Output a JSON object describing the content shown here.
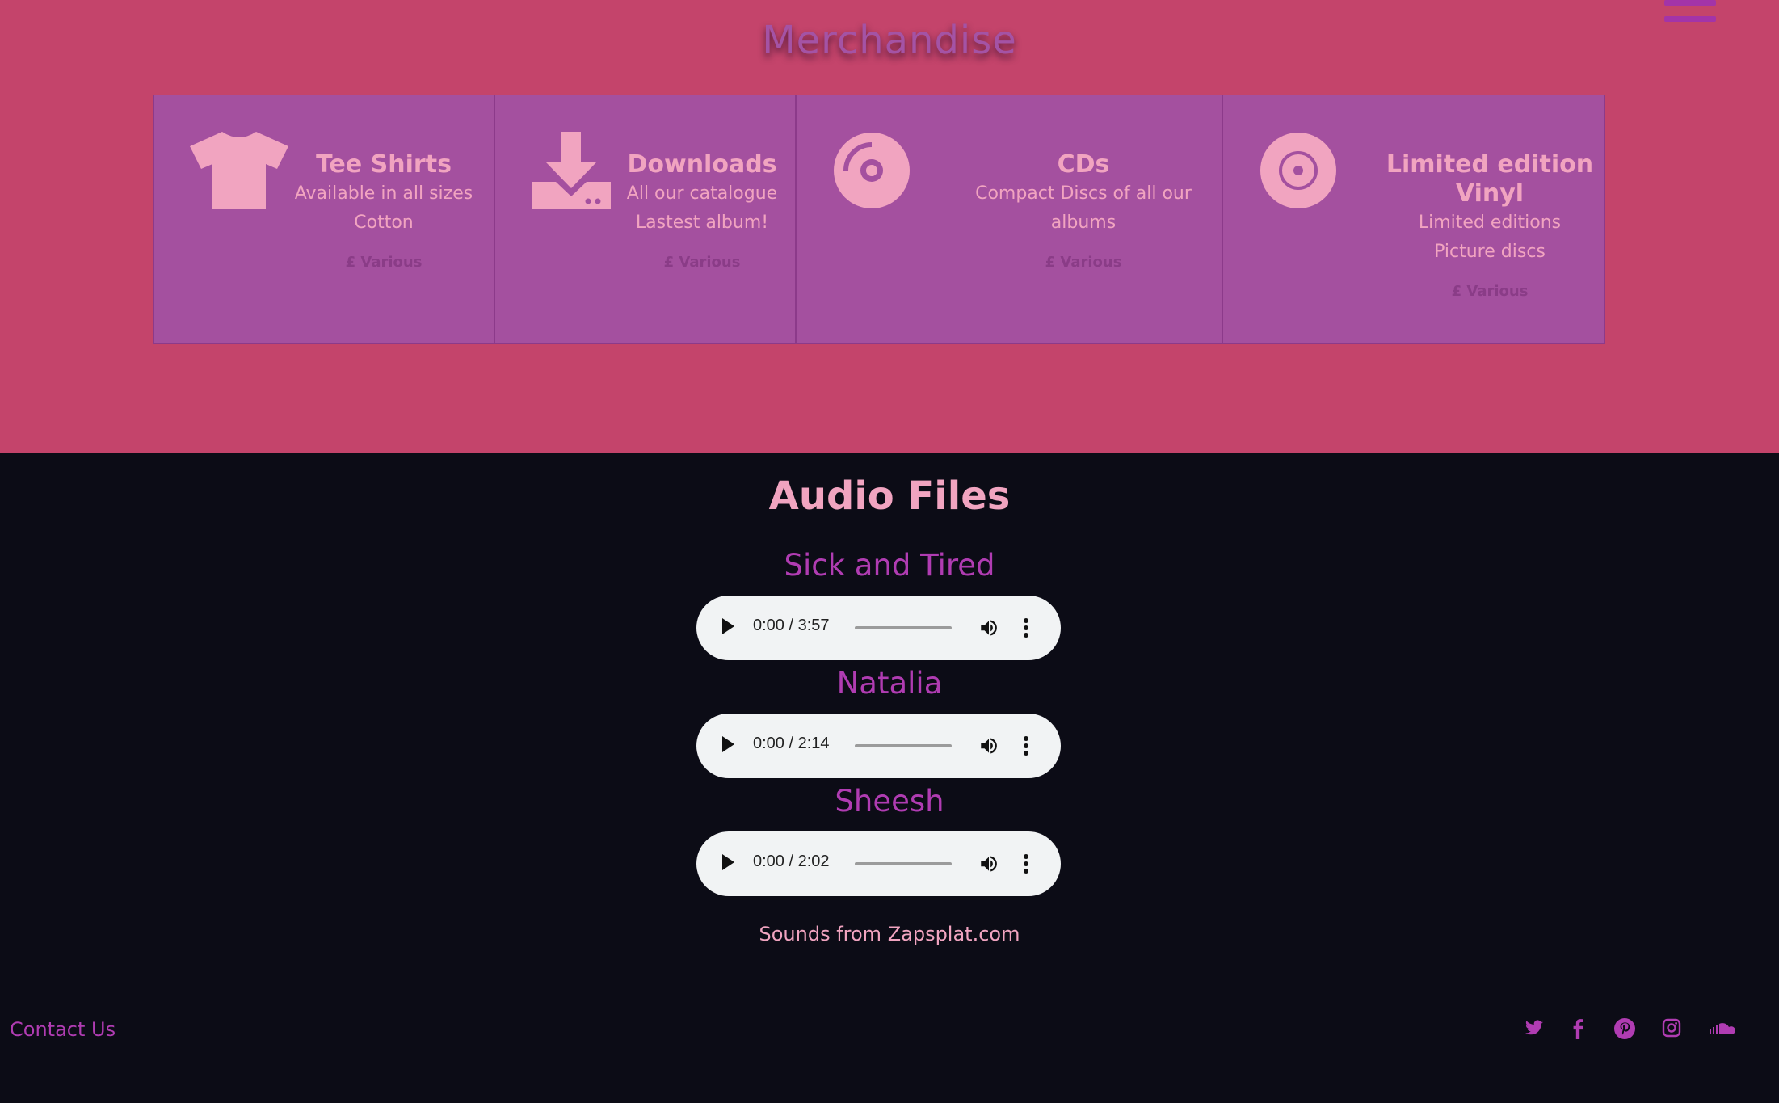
{
  "header": {
    "title": "Merchandise",
    "menu_icon": "hamburger-icon"
  },
  "merch": [
    {
      "icon": "tshirt-icon",
      "title": "Tee Shirts",
      "lines": [
        "Available in all sizes",
        "Cotton"
      ],
      "price": "£ Various"
    },
    {
      "icon": "download-icon",
      "title": "Downloads",
      "lines": [
        "All our catalogue",
        "Lastest album!"
      ],
      "price": "£ Various"
    },
    {
      "icon": "cd-icon",
      "title": "CDs",
      "lines": [
        "Compact Discs of all our",
        "albums"
      ],
      "price": "£ Various"
    },
    {
      "icon": "vinyl-icon",
      "title_lines": [
        "Limited edition",
        "Vinyl"
      ],
      "lines": [
        "Limited editions",
        "Picture discs"
      ],
      "price": "£ Various"
    }
  ],
  "audio": {
    "title": "Audio Files",
    "tracks": [
      {
        "name": "Sick and Tired",
        "time": "0:00 / 3:57"
      },
      {
        "name": "Natalia",
        "time": "0:00 / 2:14"
      },
      {
        "name": "Sheesh",
        "time": "0:00 / 2:02"
      }
    ],
    "credit": "Sounds from Zapsplat.com"
  },
  "footer": {
    "contact": "Contact Us",
    "social_icons": [
      "twitter-icon",
      "facebook-icon",
      "pinterest-icon",
      "instagram-icon",
      "soundcloud-icon"
    ]
  },
  "colors": {
    "top_bg": "#c4446b",
    "card_bg": "#a4509f",
    "accent_pink": "#f1a4c0",
    "accent_purple": "#b03cb2",
    "dark_bg": "#0c0c16"
  }
}
